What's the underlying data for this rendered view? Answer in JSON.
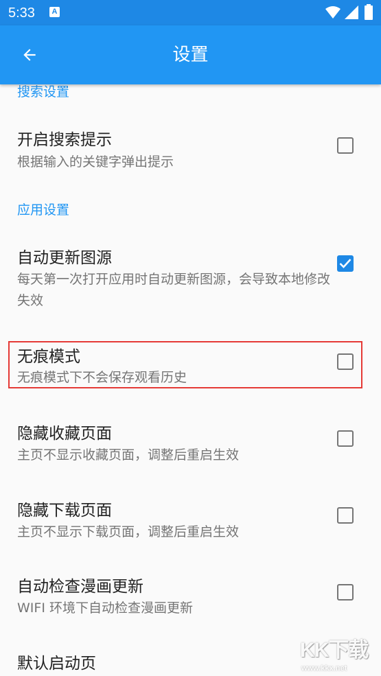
{
  "status_bar": {
    "time": "5:33",
    "app_icon_letter": "A",
    "icons": [
      "wifi-icon",
      "signal-icon",
      "battery-icon"
    ]
  },
  "app_bar": {
    "title": "设置",
    "back_icon": "arrow-back-icon"
  },
  "sections": {
    "search": {
      "header": "搜索设置",
      "items": [
        {
          "title": "开启搜索提示",
          "summary": "根据输入的关键字弹出提示",
          "checked": false
        }
      ]
    },
    "app": {
      "header": "应用设置",
      "items": [
        {
          "title": "自动更新图源",
          "summary": "每天第一次打开应用时自动更新图源，会导致本地修改失效",
          "checked": true
        },
        {
          "title": "无痕模式",
          "summary": "无痕模式下不会保存观看历史",
          "checked": false,
          "highlighted": true
        },
        {
          "title": "隐藏收藏页面",
          "summary": "主页不显示收藏页面，调整后重启生效",
          "checked": false
        },
        {
          "title": "隐藏下载页面",
          "summary": "主页不显示下载页面，调整后重启生效",
          "checked": false
        },
        {
          "title": "自动检查漫画更新",
          "summary": "WIFI 环境下自动检查漫画更新",
          "checked": false
        },
        {
          "title": "默认启动页",
          "summary": "",
          "checked": null
        }
      ]
    }
  },
  "watermark": {
    "logo": "KK下载",
    "url": "www.kkx.net"
  },
  "colors": {
    "status_bar": "#1e88e5",
    "app_bar": "#2196f3",
    "accent": "#2196f3",
    "checkbox_checked": "#1e88e5",
    "highlight_border": "#e53935"
  }
}
